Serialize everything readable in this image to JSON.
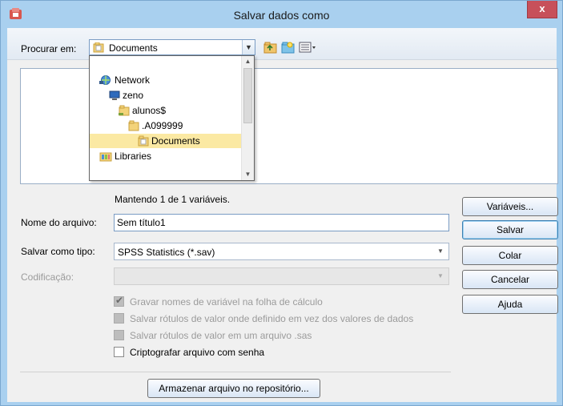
{
  "window": {
    "title": "Salvar dados como",
    "close_label": "x",
    "accent": "#a9d0ef"
  },
  "toolbar": {
    "look_in_label": "Procurar em:",
    "look_in_value": "Documents",
    "icons": [
      "up-folder-icon",
      "new-folder-icon",
      "view-menu-icon"
    ]
  },
  "dropdown": {
    "items": [
      {
        "label": "Network",
        "icon": "network-icon"
      },
      {
        "label": "zeno",
        "icon": "computer-icon"
      },
      {
        "label": "alunos$",
        "icon": "folder-icon"
      },
      {
        "label": ".A099999",
        "icon": "folder-icon"
      },
      {
        "label": "Documents",
        "icon": "documents-folder-icon",
        "selected": true
      },
      {
        "label": "Libraries",
        "icon": "libraries-icon"
      }
    ]
  },
  "status": {
    "keeping_text": "Mantendo 1 de 1 variáveis."
  },
  "form": {
    "filename_label": "Nome do arquivo:",
    "filename_value": "Sem título1",
    "save_type_label": "Salvar como tipo:",
    "save_type_value": "SPSS Statistics (*.sav)",
    "encoding_label": "Codificação:",
    "encoding_value": ""
  },
  "options": [
    {
      "label": "Gravar nomes de variável na folha de cálculo",
      "checked": true,
      "enabled": false
    },
    {
      "label": "Salvar rótulos de valor onde definido em vez dos valores de dados",
      "checked": false,
      "enabled": false
    },
    {
      "label": "Salvar rótulos de valor em um arquivo .sas",
      "checked": false,
      "enabled": false
    },
    {
      "label": "Criptografar arquivo com senha",
      "checked": false,
      "enabled": true
    }
  ],
  "buttons": {
    "variables": "Variáveis...",
    "save": "Salvar",
    "paste": "Colar",
    "cancel": "Cancelar",
    "help": "Ajuda",
    "repository": "Armazenar arquivo no repositório..."
  }
}
